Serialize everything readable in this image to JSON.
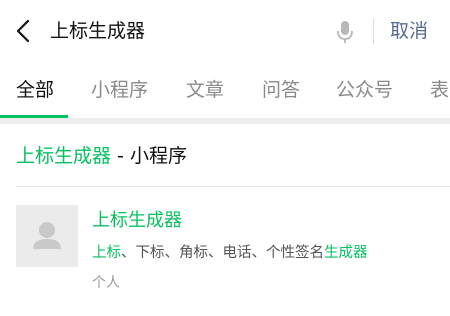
{
  "search": {
    "query": "上标生成器",
    "cancel_label": "取消"
  },
  "tabs": [
    {
      "label": "全部",
      "active": true
    },
    {
      "label": "小程序",
      "active": false
    },
    {
      "label": "文章",
      "active": false
    },
    {
      "label": "问答",
      "active": false
    },
    {
      "label": "公众号",
      "active": false
    },
    {
      "label": "表",
      "active": false
    }
  ],
  "section": {
    "highlight": "上标生成器",
    "rest": " - 小程序"
  },
  "result": {
    "title": "上标生成器",
    "desc_hl_1": "上标",
    "desc_mid": "、下标、角标、电话、个性签名",
    "desc_hl_2": "生成器",
    "type": "个人"
  },
  "colors": {
    "accent_green": "#07c160",
    "link_blue": "#576b95"
  },
  "icons": [
    "back-arrow-icon",
    "microphone-icon",
    "avatar-placeholder-icon"
  ]
}
